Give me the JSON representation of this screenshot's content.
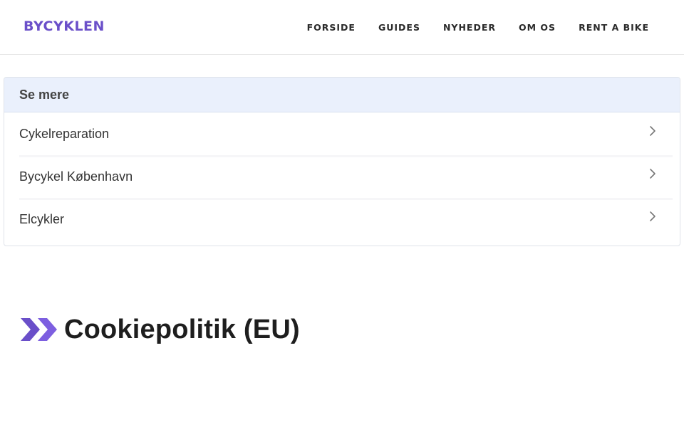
{
  "header": {
    "logo": "BYCYKLEN",
    "nav": [
      {
        "label": "FORSIDE"
      },
      {
        "label": "GUIDES"
      },
      {
        "label": "NYHEDER"
      },
      {
        "label": "OM OS"
      },
      {
        "label": "RENT A BIKE"
      }
    ]
  },
  "panel": {
    "title": "Se mere",
    "items": [
      {
        "label": "Cykelreparation",
        "icon": "chevron-right-icon"
      },
      {
        "label": "Bycykel København",
        "icon": "chevron-right-icon"
      },
      {
        "label": "Elcykler",
        "icon": "chevron-right-icon"
      }
    ]
  },
  "section": {
    "heading": "Cookiepolitik (EU)",
    "icon": "double-chevron-right-icon"
  },
  "colors": {
    "brand": "#6a4fc9",
    "panel_header_bg": "#eaf0fc"
  }
}
